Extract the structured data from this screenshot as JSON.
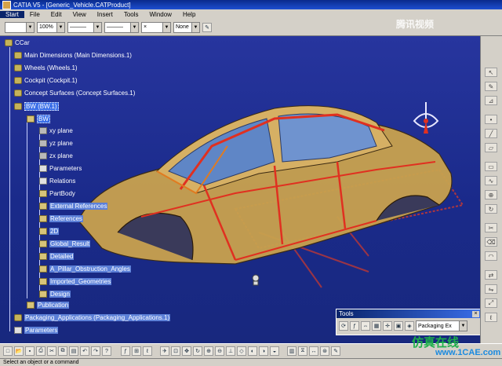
{
  "window": {
    "title": "CATIA V5 - [Generic_Vehicle.CATProduct]"
  },
  "menu": [
    "Start",
    "File",
    "Edit",
    "View",
    "Insert",
    "Tools",
    "Window",
    "Help"
  ],
  "toolbar": {
    "color_value": "",
    "transparency_value": "100%",
    "linetype_value": "———",
    "thickness_value": "———",
    "point_value": "×",
    "layer_value": "None"
  },
  "tree": {
    "root": "CCar",
    "items": [
      "Main Dimensions (Main Dimensions.1)",
      "Wheels (Wheels.1)",
      "Cockpit (Cockpit.1)",
      "Concept Surfaces (Concept Surfaces.1)",
      "BW (BW.1)"
    ],
    "bw_part": "BW",
    "bw_children": [
      "xy plane",
      "yz plane",
      "zx plane",
      "Parameters",
      "Relations",
      "PartBody",
      "External References",
      "References",
      "2D",
      "Global_Result",
      "Detailed",
      "A_Pillar_Obstruction_Angles",
      "Imported_Geometries",
      "Design"
    ],
    "after": [
      "Publication",
      "Packaging_Applications (Packaging_Applications.1)",
      "Parameters"
    ]
  },
  "tools_panel": {
    "title": "Tools",
    "close_label": "×",
    "dropdown_value": "Packaging Ex"
  },
  "status": {
    "prompt": "Select an object or a command"
  },
  "watermark": {
    "top": "腾讯视频",
    "bottom": "仿真在线",
    "url": "www.1CAE.com"
  },
  "colors": {
    "background": "#1a2a8a",
    "car_body": "#c9a24e",
    "glass": "#5f86c6",
    "highlight": "#e03020"
  }
}
